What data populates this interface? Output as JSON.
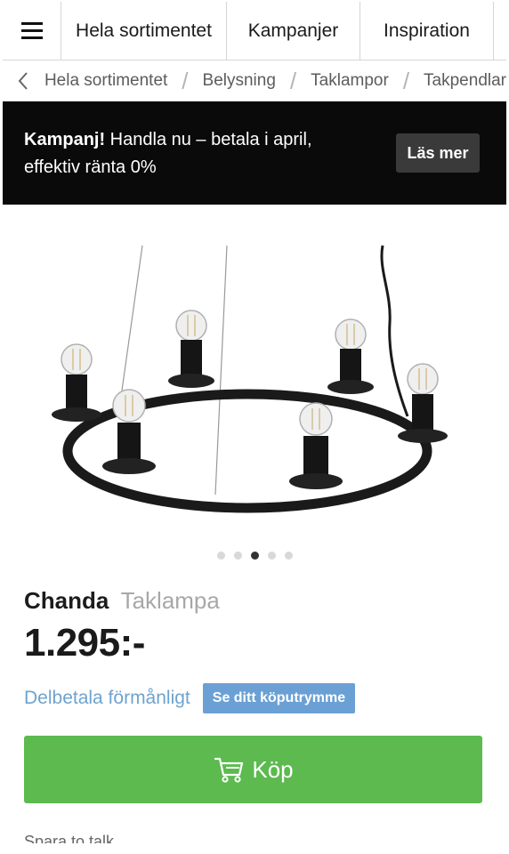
{
  "nav": {
    "items": [
      {
        "label": "Hela sortimentet"
      },
      {
        "label": "Kampanjer"
      },
      {
        "label": "Inspiration"
      }
    ]
  },
  "breadcrumb": {
    "items": [
      "Hela sortimentet",
      "Belysning",
      "Taklampor",
      "Takpendlar"
    ],
    "separator": "/"
  },
  "banner": {
    "bold": "Kampanj!",
    "text": " Handla nu – betala i april, effektiv ränta 0%",
    "button": "Läs mer"
  },
  "gallery": {
    "total_images": 5,
    "active_index": 2
  },
  "product": {
    "name": "Chanda",
    "type": "Taklampa",
    "price": "1.295:-"
  },
  "finance": {
    "link": "Delbetala förmånligt",
    "button": "Se ditt köputrymme"
  },
  "buy": {
    "label": "Köp"
  },
  "next_section": {
    "label": "Spara to talk"
  },
  "colors": {
    "banner_bg": "#0a0a0a",
    "buy_button": "#5cba4f",
    "finance_blue": "#6ba0d4",
    "finance_link": "#6ea3cf"
  }
}
